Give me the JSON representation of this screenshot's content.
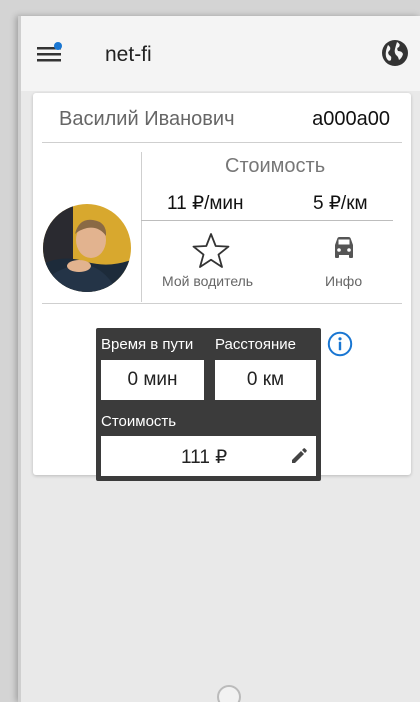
{
  "appbar": {
    "title": "net-fi",
    "menu_icon": "hamburger-menu-icon",
    "globe_icon": "globe-icon"
  },
  "driver": {
    "name": "Василий Иванович",
    "plate": "а000а00",
    "avatar_icon": "driver-avatar"
  },
  "pricing": {
    "title": "Стоимость",
    "per_minute": "11 ₽/мин",
    "per_km": "5 ₽/км"
  },
  "actions": {
    "my_driver_label": "Мой водитель",
    "info_label": "Инфо"
  },
  "trip": {
    "time_label": "Время в пути",
    "time_value": "0 мин",
    "distance_label": "Расстояние",
    "distance_value": "0 км",
    "cost_label": "Стоимость",
    "cost_value": "111 ₽"
  },
  "colors": {
    "accent_blue": "#1976d2",
    "trip_box_bg": "#3b3b3b",
    "card_bg": "#ffffff",
    "screen_bg": "#e9e9e9"
  }
}
